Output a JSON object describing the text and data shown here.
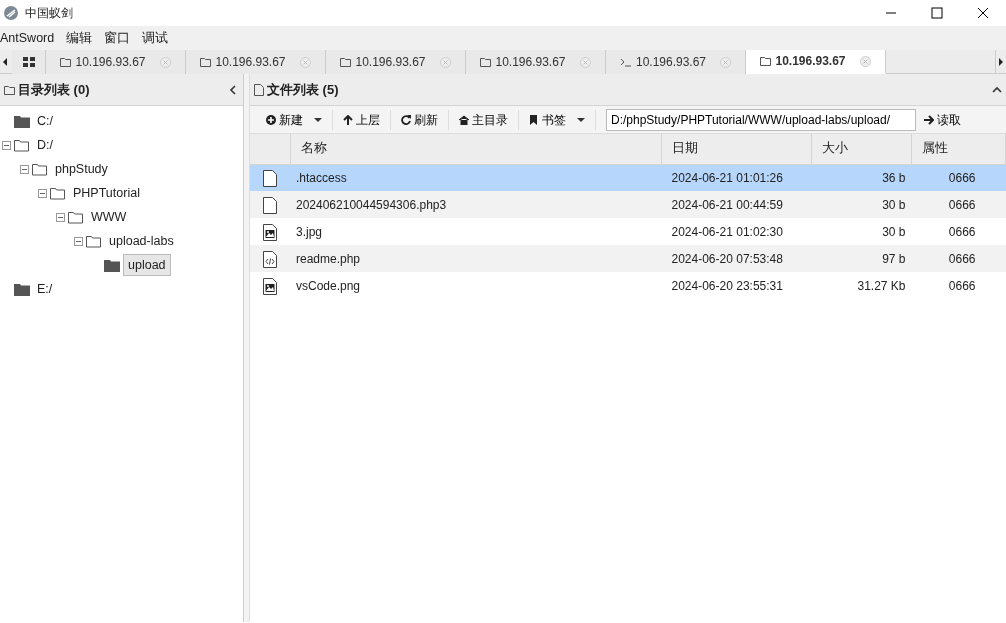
{
  "window": {
    "title": "中国蚁剑"
  },
  "menu": [
    "AntSword",
    "编辑",
    "窗口",
    "调试"
  ],
  "tabs": [
    {
      "kind": "home",
      "selected": false
    },
    {
      "kind": "folder",
      "label": "10.196.93.67",
      "selected": false
    },
    {
      "kind": "folder",
      "label": "10.196.93.67",
      "selected": false
    },
    {
      "kind": "folder",
      "label": "10.196.93.67",
      "selected": false
    },
    {
      "kind": "folder",
      "label": "10.196.93.67",
      "selected": false
    },
    {
      "kind": "terminal",
      "label": "10.196.93.67",
      "selected": false
    },
    {
      "kind": "folder",
      "label": "10.196.93.67",
      "selected": true
    }
  ],
  "dir_panel": {
    "title": "目录列表 (0)",
    "tree": [
      {
        "label": "C:/",
        "expanded": false,
        "selected": false
      },
      {
        "label": "D:/",
        "expanded": true,
        "selected": false,
        "children": [
          {
            "label": "phpStudy",
            "expanded": true,
            "selected": false,
            "children": [
              {
                "label": "PHPTutorial",
                "expanded": true,
                "selected": false,
                "children": [
                  {
                    "label": "WWW",
                    "expanded": true,
                    "selected": false,
                    "children": [
                      {
                        "label": "upload-labs",
                        "expanded": true,
                        "selected": false,
                        "children": [
                          {
                            "label": "upload",
                            "expanded": false,
                            "selected": true
                          }
                        ]
                      }
                    ]
                  }
                ]
              }
            ]
          }
        ]
      },
      {
        "label": "E:/",
        "expanded": false,
        "selected": false
      }
    ]
  },
  "file_panel": {
    "title": "文件列表 (5)",
    "toolbar": [
      {
        "kind": "plus",
        "label": "新建",
        "dropdown": true
      },
      {
        "kind": "up",
        "label": "上层",
        "dropdown": false
      },
      {
        "kind": "refresh",
        "label": "刷新",
        "dropdown": false
      },
      {
        "kind": "home",
        "label": "主目录",
        "dropdown": false
      },
      {
        "kind": "bookmark",
        "label": "书签",
        "dropdown": true
      }
    ],
    "path": "D:/phpStudy/PHPTutorial/WWW/upload-labs/upload/",
    "read_button": "读取",
    "columns": [
      "名称",
      "日期",
      "大小",
      "属性"
    ],
    "rows": [
      {
        "kind": "file",
        "name": ".htaccess",
        "date": "2024-06-21 01:01:26",
        "size": "36 b",
        "attr": "0666",
        "selected": true
      },
      {
        "kind": "file",
        "name": "202406210044594306.php3",
        "date": "2024-06-21 00:44:59",
        "size": "30 b",
        "attr": "0666",
        "selected": false
      },
      {
        "kind": "image",
        "name": "3.jpg",
        "date": "2024-06-21 01:02:30",
        "size": "30 b",
        "attr": "0666",
        "selected": false
      },
      {
        "kind": "code",
        "name": "readme.php",
        "date": "2024-06-20 07:53:48",
        "size": "97 b",
        "attr": "0666",
        "selected": false
      },
      {
        "kind": "image",
        "name": "vsCode.png",
        "date": "2024-06-20 23:55:31",
        "size": "31.27 Kb",
        "attr": "0666",
        "selected": false
      }
    ]
  }
}
